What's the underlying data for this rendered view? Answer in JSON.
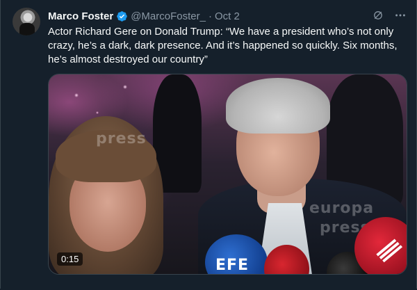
{
  "author": {
    "name": "Marco Foster",
    "handle": "@MarcoFoster_",
    "separator": "·",
    "date": "Oct 2",
    "verified": true
  },
  "tweet": {
    "text": "Actor Richard Gere on Donald Trump: “We have a president who’s not only crazy, he’s a dark, dark presence. And it’s happened so quickly. Six months, he’s almost destroyed our country”"
  },
  "media": {
    "type": "video",
    "duration": "0:15",
    "watermarks": [
      "press",
      "europa",
      "press"
    ],
    "mic_labels": [
      "EFE"
    ]
  },
  "icons": {
    "verified": "verified-badge-icon",
    "grok": "grok-icon",
    "more": "more-options-icon"
  },
  "colors": {
    "background": "#15202b",
    "text": "#f7f9f9",
    "secondary": "#8b98a5",
    "accent": "#1d9bf0"
  }
}
